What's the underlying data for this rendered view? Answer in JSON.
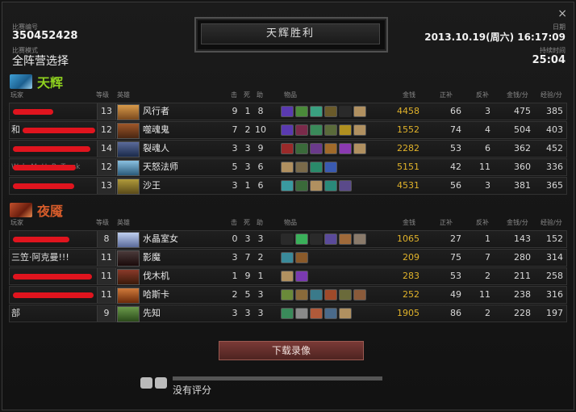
{
  "window": {
    "close_label": "×"
  },
  "match": {
    "id_label": "比赛编号",
    "id": "350452428",
    "mode_label": "比赛模式",
    "mode": "全阵营选择",
    "result": "天辉胜利",
    "date_label": "日期",
    "date": "2013.10.19(周六) 16:17:09",
    "duration_label": "持续时间",
    "duration": "25:04"
  },
  "columns": {
    "player": "玩家",
    "level": "等级",
    "hero": "英雄",
    "kills": "击",
    "deaths": "死",
    "assists": "助",
    "items": "物品",
    "gold": "金钱",
    "last_hits": "正补",
    "denies": "反补",
    "gpm": "金钱/分",
    "xpm": "经验/分"
  },
  "radiant": {
    "name": "天辉",
    "players": [
      {
        "player": "",
        "level": "13",
        "hero": "风行者",
        "k": "9",
        "d": "1",
        "a": "8",
        "gold": "4458",
        "lh": "66",
        "dn": "3",
        "gpm": "475",
        "xpm": "385"
      },
      {
        "player": "和",
        "level": "12",
        "hero": "噬魂鬼",
        "k": "7",
        "d": "2",
        "a": "10",
        "gold": "1552",
        "lh": "74",
        "dn": "4",
        "gpm": "504",
        "xpm": "403"
      },
      {
        "player": "",
        "level": "14",
        "hero": "裂魂人",
        "k": "3",
        "d": "3",
        "a": "9",
        "gold": "2282",
        "lh": "53",
        "dn": "6",
        "gpm": "362",
        "xpm": "452"
      },
      {
        "player": "WakeMeUpBeTruck",
        "level": "12",
        "hero": "天怒法师",
        "k": "5",
        "d": "3",
        "a": "6",
        "gold": "5151",
        "lh": "42",
        "dn": "11",
        "gpm": "360",
        "xpm": "336"
      },
      {
        "player": "",
        "level": "13",
        "hero": "沙王",
        "k": "3",
        "d": "1",
        "a": "6",
        "gold": "4531",
        "lh": "56",
        "dn": "3",
        "gpm": "381",
        "xpm": "365"
      }
    ]
  },
  "dire": {
    "name": "夜魇",
    "players": [
      {
        "player": "",
        "level": "8",
        "hero": "水晶室女",
        "k": "0",
        "d": "3",
        "a": "3",
        "gold": "1065",
        "lh": "27",
        "dn": "1",
        "gpm": "143",
        "xpm": "152"
      },
      {
        "player": "三笠·阿克曼!!!",
        "level": "11",
        "hero": "影魔",
        "k": "3",
        "d": "7",
        "a": "2",
        "gold": "209",
        "lh": "75",
        "dn": "7",
        "gpm": "280",
        "xpm": "314"
      },
      {
        "player": "",
        "level": "11",
        "hero": "伐木机",
        "k": "1",
        "d": "9",
        "a": "1",
        "gold": "283",
        "lh": "53",
        "dn": "2",
        "gpm": "211",
        "xpm": "258"
      },
      {
        "player": "",
        "level": "11",
        "hero": "哈斯卡",
        "k": "2",
        "d": "5",
        "a": "3",
        "gold": "252",
        "lh": "49",
        "dn": "11",
        "gpm": "238",
        "xpm": "316"
      },
      {
        "player": "部",
        "level": "9",
        "hero": "先知",
        "k": "3",
        "d": "3",
        "a": "3",
        "gold": "1905",
        "lh": "86",
        "dn": "2",
        "gpm": "228",
        "xpm": "197"
      }
    ]
  },
  "actions": {
    "download": "下载录像"
  },
  "rating": {
    "text": "没有评分"
  }
}
